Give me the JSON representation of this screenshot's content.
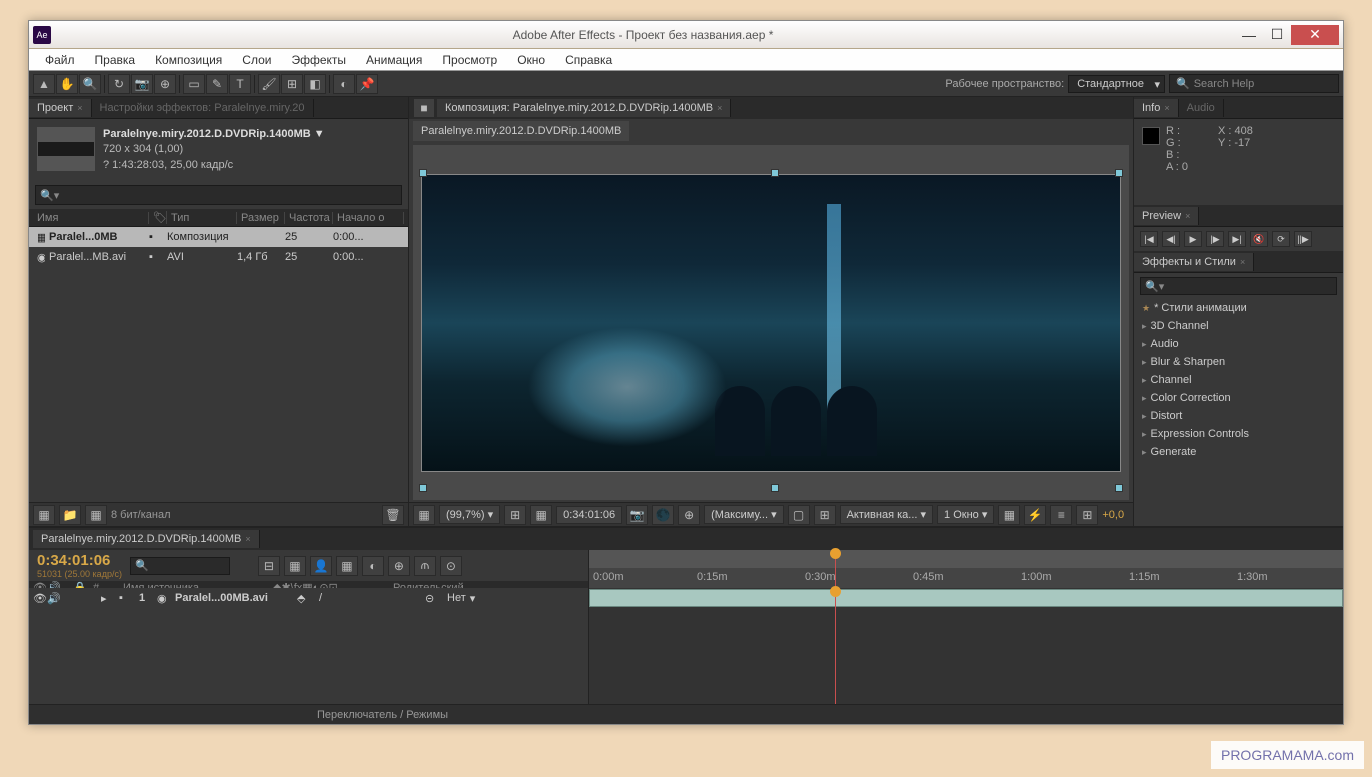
{
  "titlebar": {
    "icon": "Ae",
    "title": "Adobe After Effects - Проект без названия.aep *"
  },
  "menu": [
    "Файл",
    "Правка",
    "Композиция",
    "Слои",
    "Эффекты",
    "Анимация",
    "Просмотр",
    "Окно",
    "Справка"
  ],
  "toolbar": {
    "workspace_label": "Рабочее пространство:",
    "workspace": "Стандартное",
    "search_placeholder": "Search Help"
  },
  "project": {
    "tab": "Проект",
    "tab2": "Настройки эффектов: Paralelnye.miry.20",
    "name": "Paralelnye.miry.2012.D.DVDRip.1400MB ▼",
    "dims": "720 x 304 (1,00)",
    "dur": "? 1:43:28:03, 25,00 кадр/с",
    "headers": {
      "name": "Имя",
      "type": "Тип",
      "size": "Размер",
      "rate": "Частота",
      "start": "Начало о"
    },
    "rows": [
      {
        "name": "Paralel...0MB",
        "type": "Композиция",
        "size": "",
        "rate": "25",
        "start": "0:00..."
      },
      {
        "name": "Paralel...MB.avi",
        "type": "AVI",
        "size": "1,4 Гб",
        "rate": "25",
        "start": "0:00..."
      }
    ],
    "footer": "8 бит/канал"
  },
  "composition": {
    "tab": "Композиция: Paralelnye.miry.2012.D.DVDRip.1400MB",
    "breadcrumb": "Paralelnye.miry.2012.D.DVDRip.1400MB",
    "footer": {
      "zoom": "(99,7%)",
      "time": "0:34:01:06",
      "res": "(Максиму...",
      "camera": "Активная ка...",
      "view": "1 Окно",
      "exposure": "+0,0"
    }
  },
  "info": {
    "tab1": "Info",
    "tab2": "Audio",
    "r": "R :",
    "g": "G :",
    "b": "B :",
    "a": "A : 0",
    "x": "X : 408",
    "y": "Y : -17"
  },
  "preview": {
    "tab": "Preview"
  },
  "effects": {
    "tab": "Эффекты и Стили",
    "items": [
      "* Стили анимации",
      "3D Channel",
      "Audio",
      "Blur & Sharpen",
      "Channel",
      "Color Correction",
      "Distort",
      "Expression Controls",
      "Generate"
    ]
  },
  "timeline": {
    "tab": "Paralelnye.miry.2012.D.DVDRip.1400MB",
    "tc": "0:34:01:06",
    "fps": "51031 (25.00 кадр/с)",
    "cols": {
      "src": "Имя источника",
      "parent": "Родительский"
    },
    "layer": {
      "num": "1",
      "name": "Paralel...00MB.avi",
      "parent": "Нет"
    },
    "marks": [
      "0:00m",
      "0:15m",
      "0:30m",
      "0:45m",
      "1:00m",
      "1:15m",
      "1:30m"
    ],
    "footer": "Переключатель / Режимы"
  },
  "watermark": "PROGRAMAMA.com"
}
